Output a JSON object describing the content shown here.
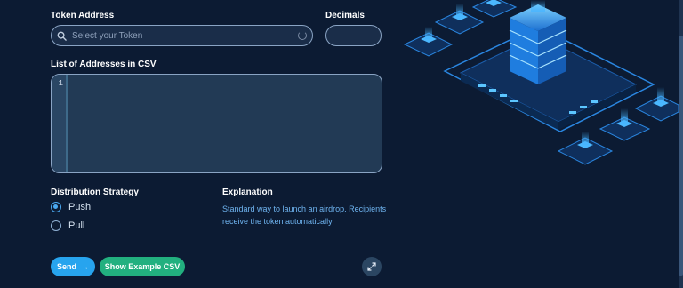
{
  "form": {
    "token_address_label": "Token Address",
    "token_placeholder": "Select your Token",
    "decimals_label": "Decimals",
    "decimals_value": "",
    "csv_label": "List of Addresses in CSV",
    "csv_line_number": "1",
    "csv_value": ""
  },
  "distribution": {
    "label": "Distribution Strategy",
    "options": [
      {
        "label": "Push",
        "checked": true
      },
      {
        "label": "Pull",
        "checked": false
      }
    ]
  },
  "explanation": {
    "label": "Explanation",
    "text": "Standard way to launch an airdrop. Recipients receive the token automatically"
  },
  "buttons": {
    "send_label": "Send",
    "send_icon": "arrow-right-icon",
    "example_label": "Show Example CSV",
    "expand_icon": "expand-icon"
  },
  "colors": {
    "background": "#0c1b33",
    "primary": "#27a4ee",
    "secondary": "#22b07f",
    "accent_text": "#6fb4f0"
  }
}
